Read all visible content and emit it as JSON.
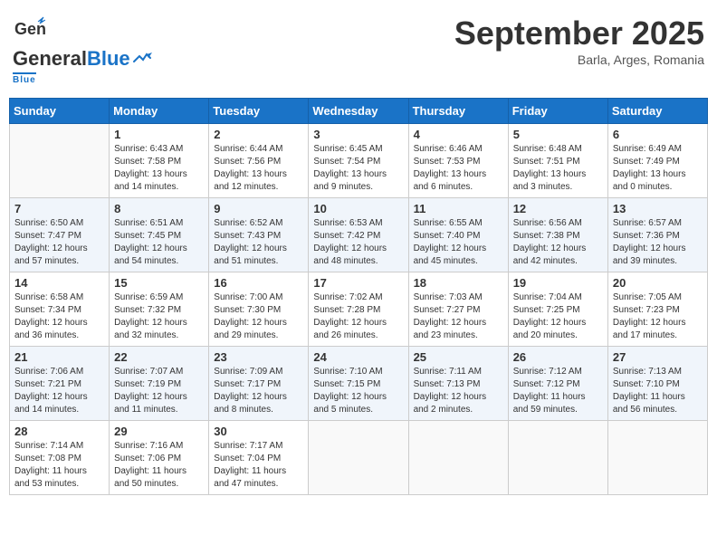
{
  "header": {
    "logo_general": "General",
    "logo_blue": "Blue",
    "month": "September 2025",
    "location": "Barla, Arges, Romania"
  },
  "days_of_week": [
    "Sunday",
    "Monday",
    "Tuesday",
    "Wednesday",
    "Thursday",
    "Friday",
    "Saturday"
  ],
  "weeks": [
    [
      {
        "day": "",
        "info": ""
      },
      {
        "day": "1",
        "info": "Sunrise: 6:43 AM\nSunset: 7:58 PM\nDaylight: 13 hours\nand 14 minutes."
      },
      {
        "day": "2",
        "info": "Sunrise: 6:44 AM\nSunset: 7:56 PM\nDaylight: 13 hours\nand 12 minutes."
      },
      {
        "day": "3",
        "info": "Sunrise: 6:45 AM\nSunset: 7:54 PM\nDaylight: 13 hours\nand 9 minutes."
      },
      {
        "day": "4",
        "info": "Sunrise: 6:46 AM\nSunset: 7:53 PM\nDaylight: 13 hours\nand 6 minutes."
      },
      {
        "day": "5",
        "info": "Sunrise: 6:48 AM\nSunset: 7:51 PM\nDaylight: 13 hours\nand 3 minutes."
      },
      {
        "day": "6",
        "info": "Sunrise: 6:49 AM\nSunset: 7:49 PM\nDaylight: 13 hours\nand 0 minutes."
      }
    ],
    [
      {
        "day": "7",
        "info": "Sunrise: 6:50 AM\nSunset: 7:47 PM\nDaylight: 12 hours\nand 57 minutes."
      },
      {
        "day": "8",
        "info": "Sunrise: 6:51 AM\nSunset: 7:45 PM\nDaylight: 12 hours\nand 54 minutes."
      },
      {
        "day": "9",
        "info": "Sunrise: 6:52 AM\nSunset: 7:43 PM\nDaylight: 12 hours\nand 51 minutes."
      },
      {
        "day": "10",
        "info": "Sunrise: 6:53 AM\nSunset: 7:42 PM\nDaylight: 12 hours\nand 48 minutes."
      },
      {
        "day": "11",
        "info": "Sunrise: 6:55 AM\nSunset: 7:40 PM\nDaylight: 12 hours\nand 45 minutes."
      },
      {
        "day": "12",
        "info": "Sunrise: 6:56 AM\nSunset: 7:38 PM\nDaylight: 12 hours\nand 42 minutes."
      },
      {
        "day": "13",
        "info": "Sunrise: 6:57 AM\nSunset: 7:36 PM\nDaylight: 12 hours\nand 39 minutes."
      }
    ],
    [
      {
        "day": "14",
        "info": "Sunrise: 6:58 AM\nSunset: 7:34 PM\nDaylight: 12 hours\nand 36 minutes."
      },
      {
        "day": "15",
        "info": "Sunrise: 6:59 AM\nSunset: 7:32 PM\nDaylight: 12 hours\nand 32 minutes."
      },
      {
        "day": "16",
        "info": "Sunrise: 7:00 AM\nSunset: 7:30 PM\nDaylight: 12 hours\nand 29 minutes."
      },
      {
        "day": "17",
        "info": "Sunrise: 7:02 AM\nSunset: 7:28 PM\nDaylight: 12 hours\nand 26 minutes."
      },
      {
        "day": "18",
        "info": "Sunrise: 7:03 AM\nSunset: 7:27 PM\nDaylight: 12 hours\nand 23 minutes."
      },
      {
        "day": "19",
        "info": "Sunrise: 7:04 AM\nSunset: 7:25 PM\nDaylight: 12 hours\nand 20 minutes."
      },
      {
        "day": "20",
        "info": "Sunrise: 7:05 AM\nSunset: 7:23 PM\nDaylight: 12 hours\nand 17 minutes."
      }
    ],
    [
      {
        "day": "21",
        "info": "Sunrise: 7:06 AM\nSunset: 7:21 PM\nDaylight: 12 hours\nand 14 minutes."
      },
      {
        "day": "22",
        "info": "Sunrise: 7:07 AM\nSunset: 7:19 PM\nDaylight: 12 hours\nand 11 minutes."
      },
      {
        "day": "23",
        "info": "Sunrise: 7:09 AM\nSunset: 7:17 PM\nDaylight: 12 hours\nand 8 minutes."
      },
      {
        "day": "24",
        "info": "Sunrise: 7:10 AM\nSunset: 7:15 PM\nDaylight: 12 hours\nand 5 minutes."
      },
      {
        "day": "25",
        "info": "Sunrise: 7:11 AM\nSunset: 7:13 PM\nDaylight: 12 hours\nand 2 minutes."
      },
      {
        "day": "26",
        "info": "Sunrise: 7:12 AM\nSunset: 7:12 PM\nDaylight: 11 hours\nand 59 minutes."
      },
      {
        "day": "27",
        "info": "Sunrise: 7:13 AM\nSunset: 7:10 PM\nDaylight: 11 hours\nand 56 minutes."
      }
    ],
    [
      {
        "day": "28",
        "info": "Sunrise: 7:14 AM\nSunset: 7:08 PM\nDaylight: 11 hours\nand 53 minutes."
      },
      {
        "day": "29",
        "info": "Sunrise: 7:16 AM\nSunset: 7:06 PM\nDaylight: 11 hours\nand 50 minutes."
      },
      {
        "day": "30",
        "info": "Sunrise: 7:17 AM\nSunset: 7:04 PM\nDaylight: 11 hours\nand 47 minutes."
      },
      {
        "day": "",
        "info": ""
      },
      {
        "day": "",
        "info": ""
      },
      {
        "day": "",
        "info": ""
      },
      {
        "day": "",
        "info": ""
      }
    ]
  ]
}
